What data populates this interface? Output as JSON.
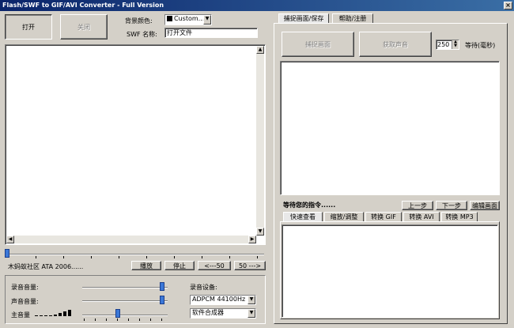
{
  "window": {
    "title": "Flash/SWF to GIF/AVI Converter - Full Version",
    "close_glyph": "×"
  },
  "toolbar": {
    "open_label": "打开",
    "close_label": "关闭"
  },
  "props": {
    "bg_color_label": "背景颜色:",
    "bg_color_value": "Custom...",
    "swf_name_label": "SWF 名称:",
    "swf_name_value": "打开文件"
  },
  "playback": {
    "status_text": "木蚂蚁社区 ATA 2006......",
    "play_label": "播放",
    "stop_label": "停止",
    "back_label": "<---50",
    "forward_label": "50 --->"
  },
  "audio": {
    "record_volume_label": "录音音量:",
    "sound_volume_label": "声音音量:",
    "master_volume_label": "主音量",
    "record_device_label": "录音设备:",
    "format_value": "ADPCM 44100Hz x1",
    "device_value": "软件合成器"
  },
  "right_tabs": {
    "capture_save": "捕捉画面/保存",
    "help_register": "帮助/注册"
  },
  "capture": {
    "capture_button": "捕捉画面",
    "get_sound_button": "获取声音",
    "wait_value": "250",
    "wait_label": "等待(毫秒)"
  },
  "status": {
    "waiting_text": "等待您的指令......",
    "prev_button": "上一步",
    "next_button": "下一步",
    "edit_button": "编辑画面"
  },
  "bottom_tabs": [
    "快速查看",
    "缩放/调整",
    "转换 GIF",
    "转换 AVI",
    "转换 MP3"
  ]
}
